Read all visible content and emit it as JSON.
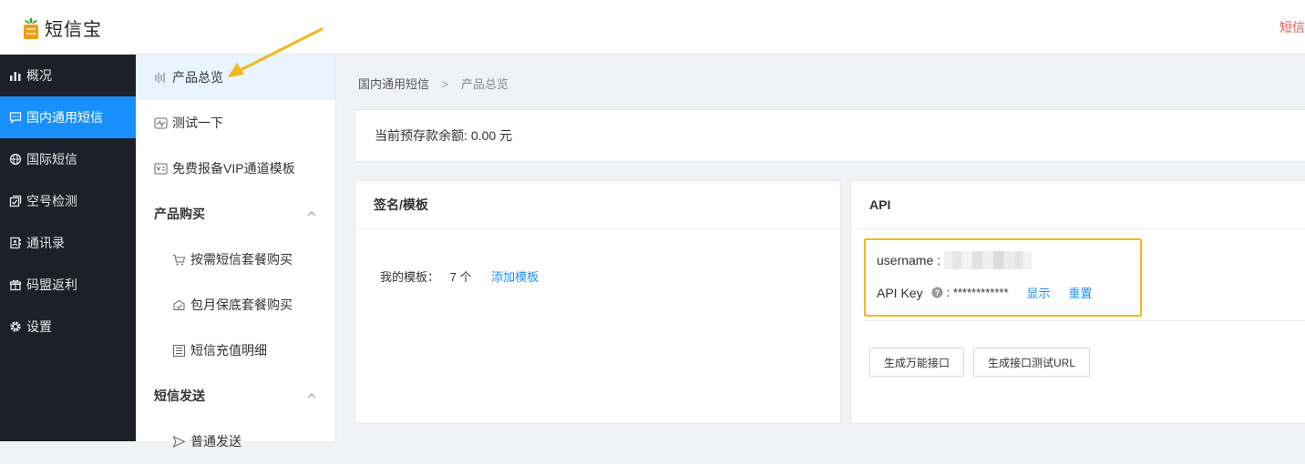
{
  "brand": {
    "name": "短信宝",
    "top_right_link": "短信"
  },
  "nav": {
    "items": [
      {
        "label": "概况",
        "icon": "bar-chart-icon",
        "active": false
      },
      {
        "label": "国内通用短信",
        "icon": "message-icon",
        "active": true
      },
      {
        "label": "国际短信",
        "icon": "globe-icon",
        "active": false
      },
      {
        "label": "空号检测",
        "icon": "check-square-icon",
        "active": false
      },
      {
        "label": "通讯录",
        "icon": "contacts-icon",
        "active": false
      },
      {
        "label": "码盟返利",
        "icon": "gift-icon",
        "active": false
      },
      {
        "label": "设置",
        "icon": "gear-icon",
        "active": false
      }
    ]
  },
  "subnav": {
    "overview": "产品总览",
    "test": "测试一下",
    "vip_template": "免费报备VIP通道模板",
    "purchase_section": "产品购买",
    "buy_package": "按需短信套餐购买",
    "monthly_package": "包月保底套餐购买",
    "recharge_detail": "短信充值明细",
    "send_section": "短信发送",
    "normal_send": "普通发送"
  },
  "breadcrumb": {
    "parent": "国内通用短信",
    "separator": ">",
    "current": "产品总览"
  },
  "balance": {
    "label": "当前预存款余额:",
    "value": "0.00 元"
  },
  "sign_card": {
    "title": "签名/模板",
    "my_templates_label": "我的模板：",
    "count": "7 个",
    "add_link": "添加模板"
  },
  "api_card": {
    "title": "API",
    "username_label": "username :",
    "api_key_label": "API Key",
    "api_key_value": ": ************",
    "show_link": "显示",
    "reset_link": "重置",
    "gen_universal_btn": "生成万能接口",
    "gen_test_url_btn": "生成接口测试URL"
  },
  "colors": {
    "accent": "#1890ff",
    "sidebar": "#1d2029",
    "highlight": "#f5b81c",
    "danger": "#e35a5a"
  }
}
